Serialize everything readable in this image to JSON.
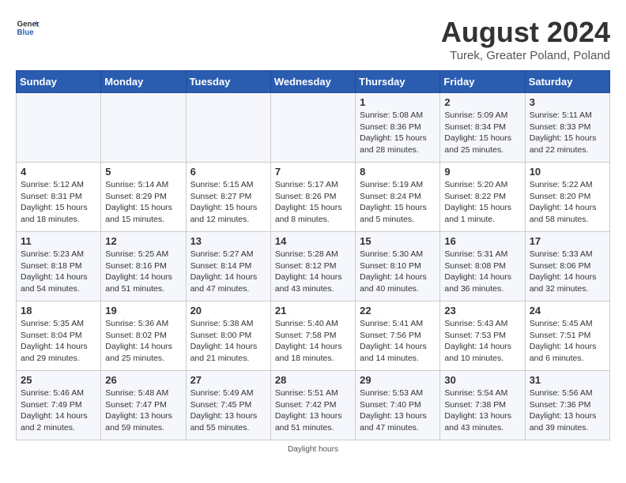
{
  "header": {
    "logo_general": "General",
    "logo_blue": "Blue",
    "month_year": "August 2024",
    "location": "Turek, Greater Poland, Poland"
  },
  "days_of_week": [
    "Sunday",
    "Monday",
    "Tuesday",
    "Wednesday",
    "Thursday",
    "Friday",
    "Saturday"
  ],
  "weeks": [
    [
      {
        "day": "",
        "info": ""
      },
      {
        "day": "",
        "info": ""
      },
      {
        "day": "",
        "info": ""
      },
      {
        "day": "",
        "info": ""
      },
      {
        "day": "1",
        "info": "Sunrise: 5:08 AM\nSunset: 8:36 PM\nDaylight: 15 hours\nand 28 minutes."
      },
      {
        "day": "2",
        "info": "Sunrise: 5:09 AM\nSunset: 8:34 PM\nDaylight: 15 hours\nand 25 minutes."
      },
      {
        "day": "3",
        "info": "Sunrise: 5:11 AM\nSunset: 8:33 PM\nDaylight: 15 hours\nand 22 minutes."
      }
    ],
    [
      {
        "day": "4",
        "info": "Sunrise: 5:12 AM\nSunset: 8:31 PM\nDaylight: 15 hours\nand 18 minutes."
      },
      {
        "day": "5",
        "info": "Sunrise: 5:14 AM\nSunset: 8:29 PM\nDaylight: 15 hours\nand 15 minutes."
      },
      {
        "day": "6",
        "info": "Sunrise: 5:15 AM\nSunset: 8:27 PM\nDaylight: 15 hours\nand 12 minutes."
      },
      {
        "day": "7",
        "info": "Sunrise: 5:17 AM\nSunset: 8:26 PM\nDaylight: 15 hours\nand 8 minutes."
      },
      {
        "day": "8",
        "info": "Sunrise: 5:19 AM\nSunset: 8:24 PM\nDaylight: 15 hours\nand 5 minutes."
      },
      {
        "day": "9",
        "info": "Sunrise: 5:20 AM\nSunset: 8:22 PM\nDaylight: 15 hours\nand 1 minute."
      },
      {
        "day": "10",
        "info": "Sunrise: 5:22 AM\nSunset: 8:20 PM\nDaylight: 14 hours\nand 58 minutes."
      }
    ],
    [
      {
        "day": "11",
        "info": "Sunrise: 5:23 AM\nSunset: 8:18 PM\nDaylight: 14 hours\nand 54 minutes."
      },
      {
        "day": "12",
        "info": "Sunrise: 5:25 AM\nSunset: 8:16 PM\nDaylight: 14 hours\nand 51 minutes."
      },
      {
        "day": "13",
        "info": "Sunrise: 5:27 AM\nSunset: 8:14 PM\nDaylight: 14 hours\nand 47 minutes."
      },
      {
        "day": "14",
        "info": "Sunrise: 5:28 AM\nSunset: 8:12 PM\nDaylight: 14 hours\nand 43 minutes."
      },
      {
        "day": "15",
        "info": "Sunrise: 5:30 AM\nSunset: 8:10 PM\nDaylight: 14 hours\nand 40 minutes."
      },
      {
        "day": "16",
        "info": "Sunrise: 5:31 AM\nSunset: 8:08 PM\nDaylight: 14 hours\nand 36 minutes."
      },
      {
        "day": "17",
        "info": "Sunrise: 5:33 AM\nSunset: 8:06 PM\nDaylight: 14 hours\nand 32 minutes."
      }
    ],
    [
      {
        "day": "18",
        "info": "Sunrise: 5:35 AM\nSunset: 8:04 PM\nDaylight: 14 hours\nand 29 minutes."
      },
      {
        "day": "19",
        "info": "Sunrise: 5:36 AM\nSunset: 8:02 PM\nDaylight: 14 hours\nand 25 minutes."
      },
      {
        "day": "20",
        "info": "Sunrise: 5:38 AM\nSunset: 8:00 PM\nDaylight: 14 hours\nand 21 minutes."
      },
      {
        "day": "21",
        "info": "Sunrise: 5:40 AM\nSunset: 7:58 PM\nDaylight: 14 hours\nand 18 minutes."
      },
      {
        "day": "22",
        "info": "Sunrise: 5:41 AM\nSunset: 7:56 PM\nDaylight: 14 hours\nand 14 minutes."
      },
      {
        "day": "23",
        "info": "Sunrise: 5:43 AM\nSunset: 7:53 PM\nDaylight: 14 hours\nand 10 minutes."
      },
      {
        "day": "24",
        "info": "Sunrise: 5:45 AM\nSunset: 7:51 PM\nDaylight: 14 hours\nand 6 minutes."
      }
    ],
    [
      {
        "day": "25",
        "info": "Sunrise: 5:46 AM\nSunset: 7:49 PM\nDaylight: 14 hours\nand 2 minutes."
      },
      {
        "day": "26",
        "info": "Sunrise: 5:48 AM\nSunset: 7:47 PM\nDaylight: 13 hours\nand 59 minutes."
      },
      {
        "day": "27",
        "info": "Sunrise: 5:49 AM\nSunset: 7:45 PM\nDaylight: 13 hours\nand 55 minutes."
      },
      {
        "day": "28",
        "info": "Sunrise: 5:51 AM\nSunset: 7:42 PM\nDaylight: 13 hours\nand 51 minutes."
      },
      {
        "day": "29",
        "info": "Sunrise: 5:53 AM\nSunset: 7:40 PM\nDaylight: 13 hours\nand 47 minutes."
      },
      {
        "day": "30",
        "info": "Sunrise: 5:54 AM\nSunset: 7:38 PM\nDaylight: 13 hours\nand 43 minutes."
      },
      {
        "day": "31",
        "info": "Sunrise: 5:56 AM\nSunset: 7:36 PM\nDaylight: 13 hours\nand 39 minutes."
      }
    ]
  ],
  "footer_note": "Daylight hours"
}
